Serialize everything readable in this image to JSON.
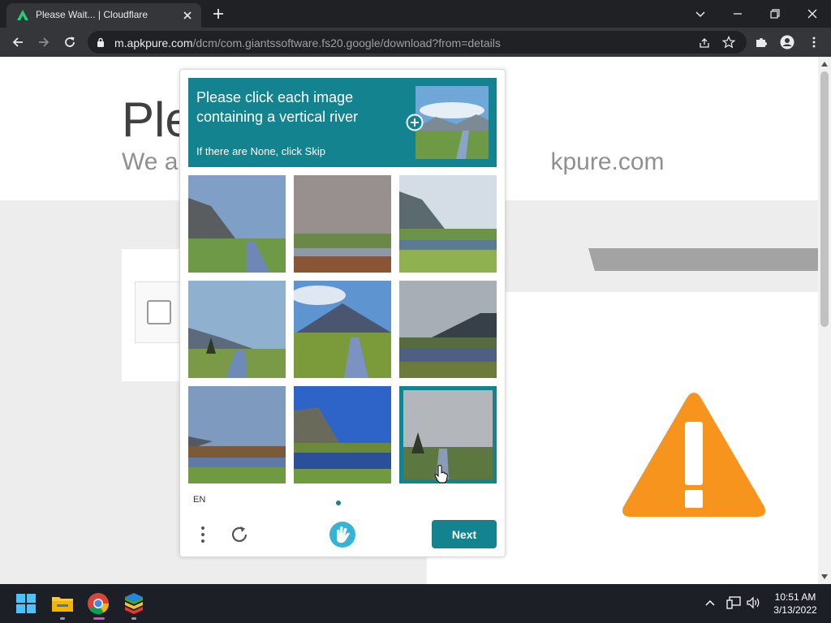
{
  "browser": {
    "tab_title": "Please Wait... | Cloudflare",
    "url_host": "m.apkpure.com",
    "url_path": "/dcm/com.giantssoftware.fs20.google/download?from=details"
  },
  "page": {
    "heading": "Ple",
    "subheading_left": "We ar",
    "subheading_right": "kpure.com"
  },
  "captcha": {
    "prompt": "Please click each image containing a vertical river",
    "prompt_sub": "If there are None, click Skip",
    "language": "EN",
    "next_label": "Next",
    "tiles": [
      {
        "selected": false
      },
      {
        "selected": false
      },
      {
        "selected": false
      },
      {
        "selected": false
      },
      {
        "selected": false
      },
      {
        "selected": false
      },
      {
        "selected": false
      },
      {
        "selected": false
      },
      {
        "selected": true
      }
    ],
    "accent_color": "#13838f"
  },
  "taskbar": {
    "apps": [
      "windows-start",
      "file-explorer",
      "chrome",
      "bluestacks"
    ],
    "time": "10:51 AM",
    "date": "3/13/2022"
  },
  "colors": {
    "warning": "#f7941d",
    "chrome_dark": "#202124",
    "toolbar": "#35363a"
  }
}
